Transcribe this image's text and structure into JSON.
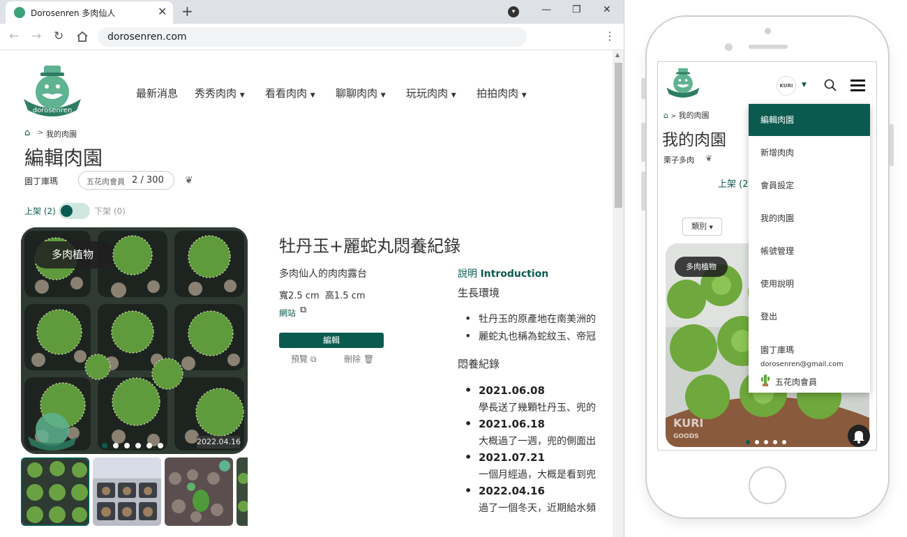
{
  "browser": {
    "tab_title": "Dorosenren 多肉仙人",
    "url": "dorosenren.com"
  },
  "nav": {
    "items": [
      {
        "label": "最新消息",
        "dropdown": false
      },
      {
        "label": "秀秀肉肉",
        "dropdown": true
      },
      {
        "label": "看看肉肉",
        "dropdown": true
      },
      {
        "label": "聊聊肉肉",
        "dropdown": true
      },
      {
        "label": "玩玩肉肉",
        "dropdown": true
      },
      {
        "label": "拍拍肉肉",
        "dropdown": true
      }
    ]
  },
  "breadcrumb": {
    "current": "我的肉園"
  },
  "page": {
    "title": "編輯肉園",
    "gardener": "園丁庫瑪",
    "member_label": "五花肉會員",
    "member_count": "2 / 300"
  },
  "shelf": {
    "on_label": "上架 (2)",
    "off_label": "下架 (0)"
  },
  "post": {
    "category": "多肉植物",
    "photo_date": "2022.04.16",
    "title": "牡丹玉+麗蛇丸悶養紀錄",
    "terrace": "多肉仙人的肉肉露台",
    "size": "寬2.5 cm  高1.5 cm",
    "website": "網站",
    "edit": "編輯",
    "preview": "預覽",
    "delete": "刪除",
    "intro_label": "說明",
    "intro_en": "Introduction",
    "env_heading": "生長環境",
    "env_points": [
      "牡丹玉的原產地在南美洲的",
      "麗蛇丸也稱為蛇紋玉、帝冠"
    ],
    "log_heading": "悶養紀錄",
    "log": [
      {
        "date": "2021.06.08",
        "note": "學長送了幾顆牡丹玉、兜的"
      },
      {
        "date": "2021.06.18",
        "note": "大概過了一週，兜的側面出"
      },
      {
        "date": "2021.07.21",
        "note": "一個月經過，大概是看到兜"
      },
      {
        "date": "2022.04.16",
        "note": "過了一個冬天，近期給水頻"
      }
    ]
  },
  "mobile": {
    "crumb": "我的肉園",
    "title": "我的肉園",
    "gardener": "栗子多肉",
    "shelf": "上架 (2",
    "category_select": "類別",
    "category": "多肉植物",
    "avatar_text": "KURI",
    "watermark": "KURI",
    "watermark_sub": "GOODS",
    "menu": [
      {
        "label": "編輯肉園",
        "active": true
      },
      {
        "label": "新增肉肉",
        "active": false
      },
      {
        "label": "會員設定",
        "active": false
      },
      {
        "label": "我的肉園",
        "active": false
      },
      {
        "label": "帳號管理",
        "active": false
      },
      {
        "label": "使用說明",
        "active": false
      },
      {
        "label": "登出",
        "active": false
      }
    ],
    "user_name": "園丁庫瑪",
    "user_email": "dorosenren@gmail.com",
    "user_member": "五花肉會員"
  },
  "colors": {
    "brand": "#0b5a4f",
    "mint": "#5fb391"
  },
  "logo_text": "dorosenren"
}
